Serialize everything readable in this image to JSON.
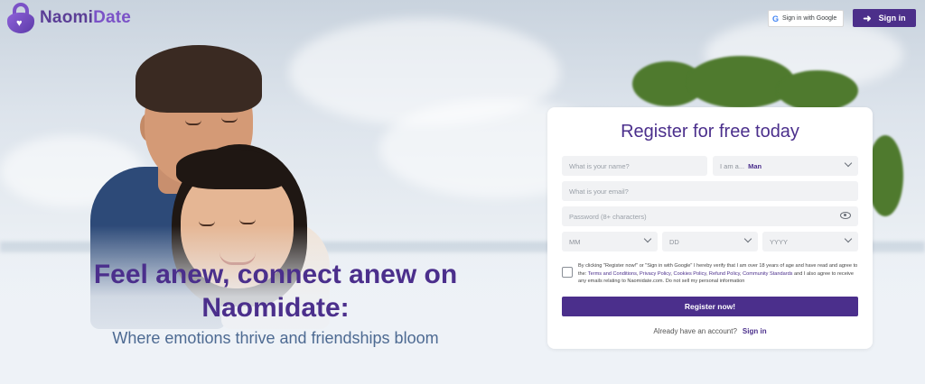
{
  "colors": {
    "brand_primary": "#4b2f8c",
    "brand_light": "#7b52c7",
    "subtitle_blue": "#4d6a92",
    "field_bg": "#f1f2f4"
  },
  "header": {
    "logo_part1": "Naomi",
    "logo_part2": "Date",
    "logo_icon": "lock-heart-icon",
    "google_label": "Sign in with Google",
    "signin_label": "Sign in",
    "signin_icon": "login-arrow-icon"
  },
  "hero": {
    "title": "Feel anew, connect anew on Naomidate:",
    "subtitle": "Where emotions thrive and friendships bloom"
  },
  "form": {
    "title": "Register for free today",
    "name_placeholder": "What is your name?",
    "iam_label": "I am a...",
    "iam_value": "Man",
    "email_placeholder": "What is your email?",
    "password_placeholder": "Password (8+ characters)",
    "month_placeholder": "MM",
    "day_placeholder": "DD",
    "year_placeholder": "YYYY",
    "terms_prefix": "By clicking \"Register now!\" or \"Sign in with Google\" I hereby verify that I am over 18 years of age and have read and agree to the:",
    "terms_links": [
      "Terms and Conditions",
      "Privacy Policy",
      "Cookies Policy",
      "Refund Policy",
      "Community Standards"
    ],
    "terms_suffix": "and I also agree to receive any emails relating to Naomidate.com. Do not sell my personal information",
    "register_label": "Register now!",
    "account_question": "Already have an account?",
    "account_signin": "Sign in"
  }
}
